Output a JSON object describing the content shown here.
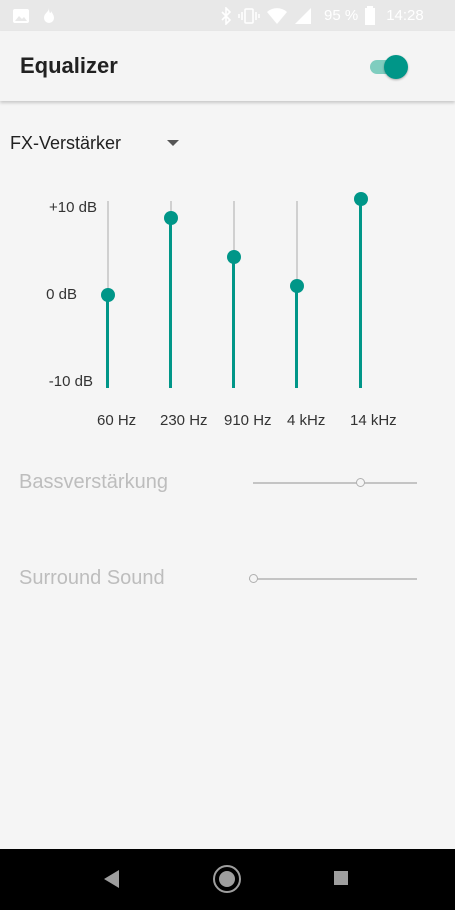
{
  "status_bar": {
    "battery": "95 %",
    "time": "14:28",
    "icons": [
      "image-icon",
      "fire-icon",
      "bluetooth-icon",
      "vibrate-icon",
      "wifi-icon",
      "signal-icon",
      "battery-icon"
    ]
  },
  "header": {
    "title": "Equalizer",
    "toggle_on": true,
    "accent": "#009688"
  },
  "preset": {
    "label": "FX-Verstärker"
  },
  "equalizer": {
    "scale": [
      "+10 dB",
      "0 dB",
      "-10 dB"
    ],
    "bands": [
      {
        "freq": "60 Hz",
        "level": 0.0
      },
      {
        "freq": "230 Hz",
        "level": 8.4
      },
      {
        "freq": "910 Hz",
        "level": 4.1
      },
      {
        "freq": "4 kHz",
        "level": 1.0
      },
      {
        "freq": "14 kHz",
        "level": 10.5
      }
    ]
  },
  "effects": {
    "bass": {
      "label": "Bassverstärkung",
      "value": 0.67
    },
    "surround": {
      "label": "Surround Sound",
      "value": 0.0
    }
  },
  "nav": {
    "icons": [
      "back-icon",
      "home-icon",
      "recents-icon"
    ]
  }
}
